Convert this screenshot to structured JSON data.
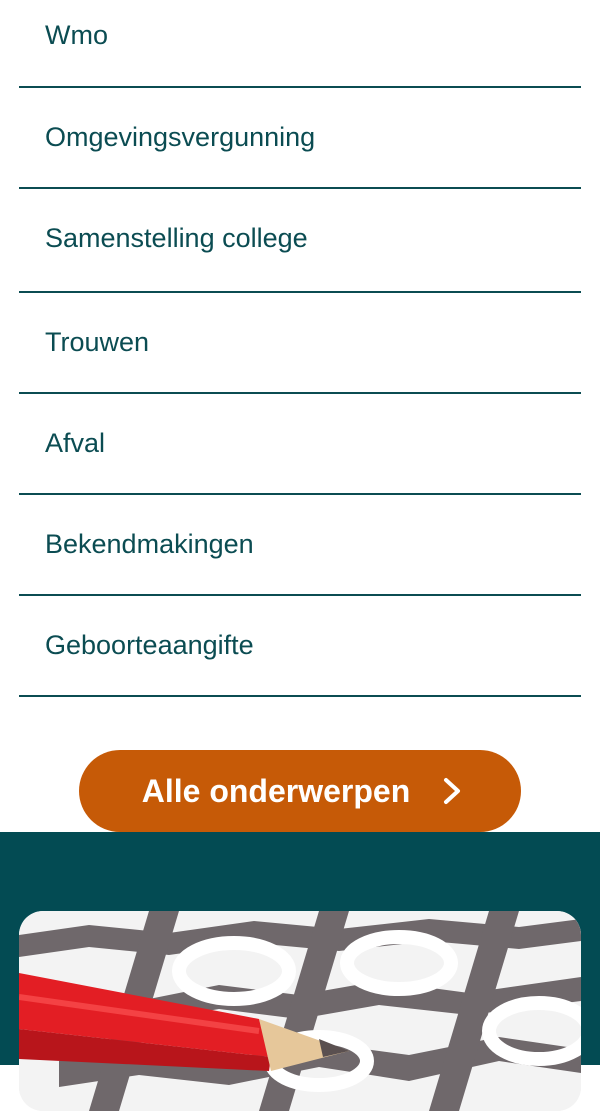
{
  "topics": {
    "items": [
      {
        "label": "Wmo"
      },
      {
        "label": "Omgevingsvergunning"
      },
      {
        "label": "Samenstelling college"
      },
      {
        "label": "Trouwen"
      },
      {
        "label": "Afval"
      },
      {
        "label": "Bekendmakingen"
      },
      {
        "label": "Geboorteaangifte"
      }
    ]
  },
  "cta": {
    "label": "Alle onderwerpen",
    "icon": "chevron-right-icon"
  },
  "colors": {
    "text": "#0b4c52",
    "cta_bg": "#c65a07",
    "footer_bg": "#034b53"
  },
  "footer": {
    "image": "ballot-pencil-photo"
  }
}
